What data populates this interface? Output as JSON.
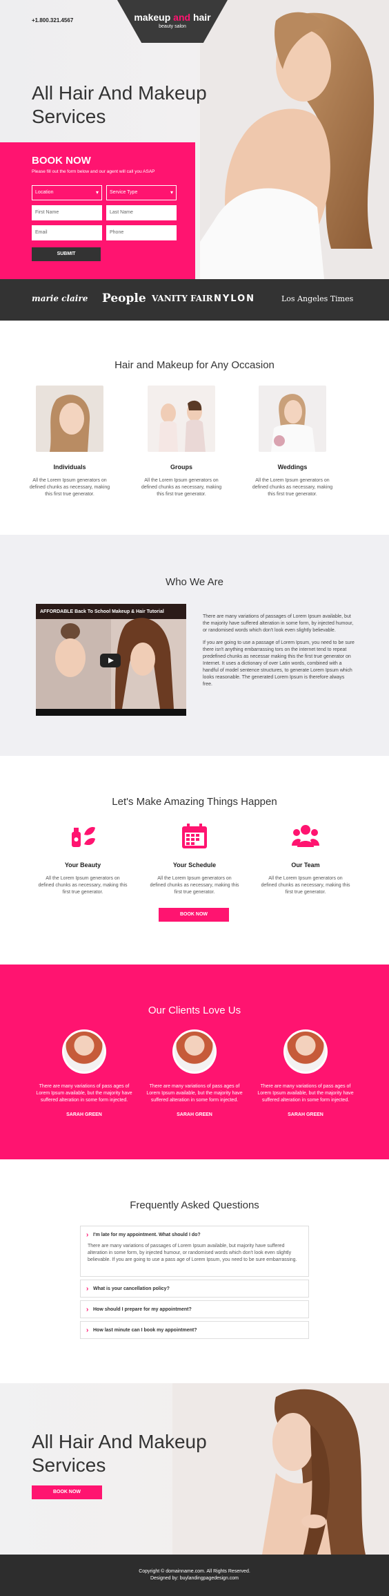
{
  "header": {
    "phone": "+1.800.321.4567",
    "logo_part1": "makeup ",
    "logo_accent": "and",
    "logo_part2": " hair",
    "logo_sub": "beauty salon"
  },
  "hero": {
    "title": "All Hair And Makeup Services"
  },
  "booking": {
    "title": "BOOK NOW",
    "subtitle": "Please fill out the form below and our agent will call you ASAP",
    "location": "Location",
    "service_type": "Service Type",
    "first_name": "First Name",
    "last_name": "Last Name",
    "email": "Email",
    "phone": "Phone",
    "submit": "SUBMIT"
  },
  "press": [
    "marie claire",
    "People",
    "VANITY FAIR",
    "NYLON",
    "Los Angeles Times"
  ],
  "occasions": {
    "title": "Hair and Makeup for Any Occasion",
    "items": [
      {
        "name": "Individuals",
        "text": "All the Lorem Ipsum generators on defined chunks as necessary, making this first true generator."
      },
      {
        "name": "Groups",
        "text": "All the Lorem Ipsum generators on defined chunks as necessary, making this first true generator."
      },
      {
        "name": "Weddings",
        "text": "All the Lorem Ipsum generators on defined chunks as necessary, making this first true generator."
      }
    ]
  },
  "who": {
    "title": "Who We Are",
    "video_title": "AFFORDABLE Back To School Makeup & Hair Tutorial",
    "p1": "There are many variations of passages of Lorem Ipsum available, but the majority have suffered alteration in some form, by injected humour, or randomised words which don't look even slightly believable.",
    "p2": "If you are going to use a passage of Lorem Ipsum, you need to be sure there isn't anything embarrassing tors on the internet tend to repeat predefined chunks as necessar making this the first true generator on Internet. It uses a dictionary of over Latin words, combined with a handful of model sentence structures, to generate Lorem Ipsum which looks reasonable. The generated Lorem Ipsum is therefore always free."
  },
  "amazing": {
    "title": "Let's Make Amazing Things Happen",
    "items": [
      {
        "name": "Your Beauty",
        "text": "All the Lorem Ipsum generators on defined chunks as necessary, making this first true generator.",
        "icon": "beauty-icon"
      },
      {
        "name": "Your Schedule",
        "text": "All the Lorem Ipsum generators on defined chunks as necessary, making this first true generator.",
        "icon": "calendar-icon"
      },
      {
        "name": "Our Team",
        "text": "All the Lorem Ipsum generators on defined chunks as necessary, making this first true generator.",
        "icon": "team-icon"
      }
    ],
    "button": "BOOK NOW"
  },
  "clients": {
    "title": "Our Clients Love Us",
    "items": [
      {
        "quote": "There are many variations of pass ages of Lorem Ipsum available, but the majority have suffered alteration in some form injected.",
        "name": "SARAH GREEN"
      },
      {
        "quote": "There are many variations of pass ages of Lorem Ipsum available, but the majority have suffered alteration in some form injected.",
        "name": "SARAH GREEN"
      },
      {
        "quote": "There are many variations of pass ages of Lorem Ipsum available, but the majority have suffered alteration in some form injected.",
        "name": "SARAH GREEN"
      }
    ]
  },
  "faq": {
    "title": "Frequently Asked Questions",
    "items": [
      {
        "q": "I'm late for my appointment. What should I do?",
        "a": "There are many variations of passages of Lorem Ipsum available, but majority have suffered alteration in some form, by injected humour, or randomised words which don't look even slightly believable. If you are going to use a pass age of Lorem Ipsum, you need to be sure embarrassing."
      },
      {
        "q": "What is your cancellation policy?"
      },
      {
        "q": "How should I prepare for my appointment?"
      },
      {
        "q": "How last minute can I book my appointment?"
      }
    ]
  },
  "cta": {
    "title": "All Hair And Makeup Services",
    "button": "BOOK NOW"
  },
  "footer": {
    "copyright": "Copyright © domainname.com. All Rights Reserved.",
    "designed": "Designed by: buylandingpagedesign.com"
  },
  "colors": {
    "accent": "#ff1470",
    "dark": "#333333",
    "light_bg": "#f0f0f3"
  }
}
